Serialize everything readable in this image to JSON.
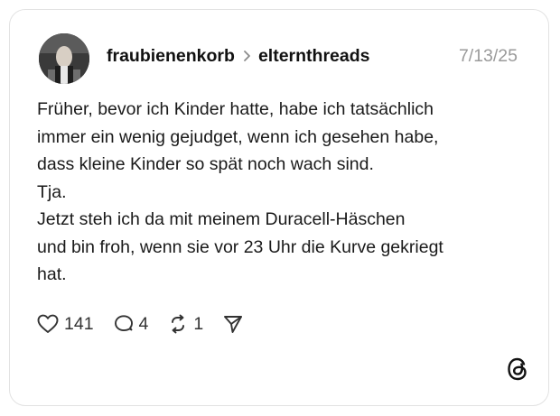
{
  "post": {
    "author": "fraubienenkorb",
    "community": "elternthreads",
    "date": "7/13/25",
    "body_lines": [
      "Früher, bevor ich Kinder hatte, habe ich tatsächlich",
      "immer ein wenig gejudget, wenn ich gesehen habe,",
      "dass kleine Kinder so spät noch wach sind.",
      "Tja.",
      "Jetzt steh ich da mit meinem Duracell-Häschen",
      "und bin froh, wenn sie vor 23 Uhr die Kurve gekriegt",
      "hat."
    ]
  },
  "actions": {
    "likes": "141",
    "replies": "4",
    "reposts": "1"
  },
  "icons": {
    "separator": "chevron-right-icon",
    "like": "heart-icon",
    "reply": "speech-bubble-icon",
    "repost": "repost-icon",
    "share": "send-icon",
    "brand": "threads-logo-icon"
  },
  "colors": {
    "text": "#1a1a1a",
    "muted": "#9a9a9a",
    "border": "#e2e2e2"
  }
}
